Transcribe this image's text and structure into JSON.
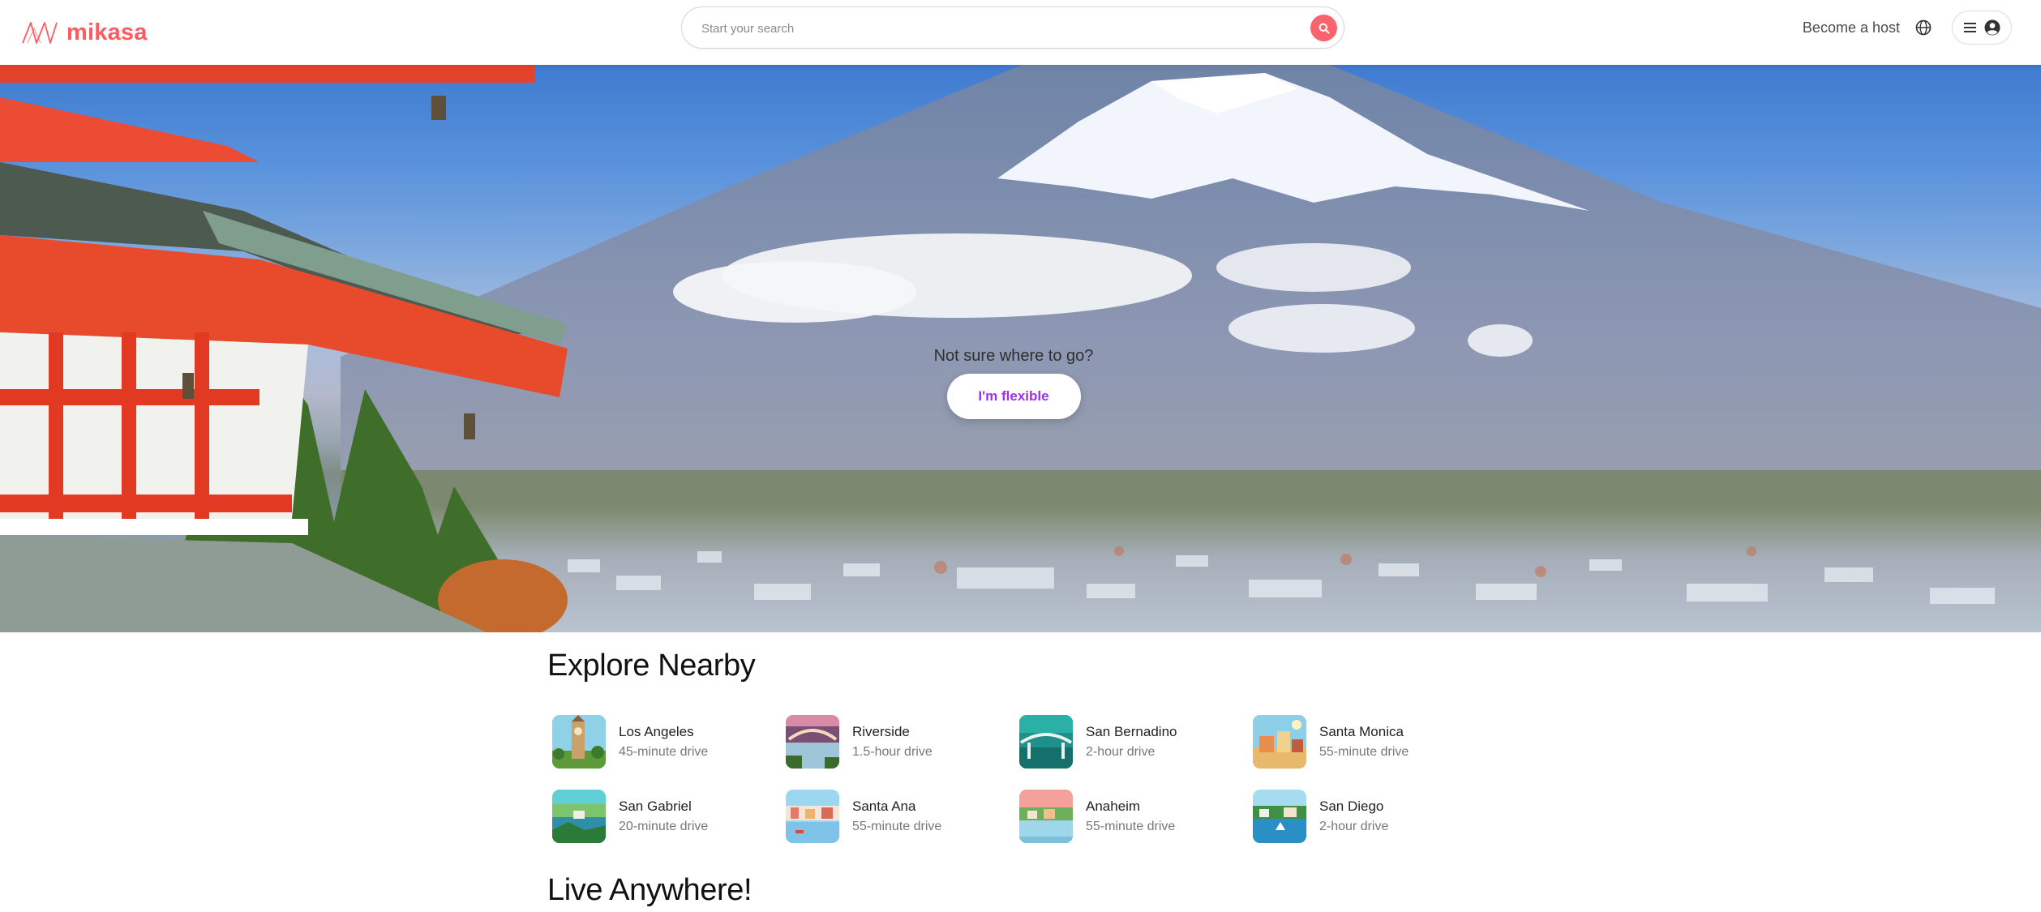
{
  "brand": {
    "name": "mikasa",
    "color": "#fd5b61"
  },
  "search": {
    "placeholder": "Start your search",
    "button_icon": "search-icon"
  },
  "nav": {
    "host_label": "Become a host",
    "globe_icon": "globe-icon",
    "menu_icon": "hamburger-menu-icon",
    "avatar_icon": "user-avatar-icon"
  },
  "hero": {
    "question": "Not sure where to go?",
    "button_label": "I'm flexible",
    "button_color": "#9b32e6"
  },
  "explore": {
    "title": "Explore Nearby",
    "items": [
      {
        "city": "Los Angeles",
        "distance": "45-minute drive"
      },
      {
        "city": "Riverside",
        "distance": "1.5-hour drive"
      },
      {
        "city": "San Bernadino",
        "distance": "2-hour drive"
      },
      {
        "city": "Santa Monica",
        "distance": "55-minute drive"
      },
      {
        "city": "San Gabriel",
        "distance": "20-minute drive"
      },
      {
        "city": "Santa Ana",
        "distance": "55-minute drive"
      },
      {
        "city": "Anaheim",
        "distance": "55-minute drive"
      },
      {
        "city": "San Diego",
        "distance": "2-hour drive"
      }
    ]
  },
  "live": {
    "title": "Live Anywhere!"
  }
}
